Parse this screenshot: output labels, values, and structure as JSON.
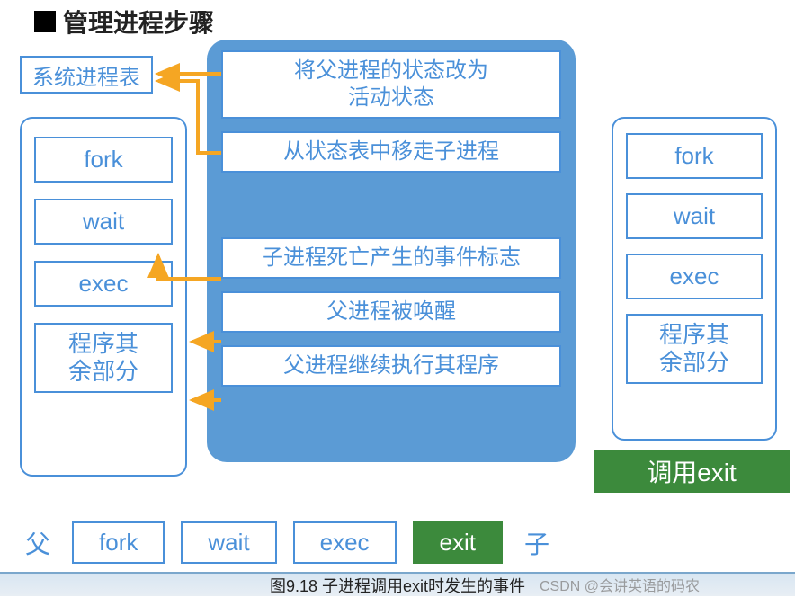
{
  "title": "管理进程步骤",
  "sys_table": "系统进程表",
  "left_panel": {
    "items": [
      "fork",
      "wait",
      "exec",
      "程序其\n余部分"
    ]
  },
  "center_panel": {
    "items": [
      "将父进程的状态改为\n活动状态",
      "从状态表中移走子进程",
      "子进程死亡产生的事件标志",
      "父进程被唤醒",
      "父进程继续执行其程序"
    ]
  },
  "right_panel": {
    "items": [
      "fork",
      "wait",
      "exec",
      "程序其\n余部分"
    ]
  },
  "call_exit": "调用exit",
  "bottom_row": {
    "left_label": "父",
    "buttons": [
      "fork",
      "wait",
      "exec",
      "exit"
    ],
    "right_label": "子"
  },
  "caption": "图9.18 子进程调用exit时发生的事件",
  "watermark": "CSDN @会讲英语的码农",
  "colors": {
    "blue": "#5b9bd5",
    "border": "#4a90d9",
    "green": "#3c8a3c",
    "arrow": "#f5a623"
  }
}
